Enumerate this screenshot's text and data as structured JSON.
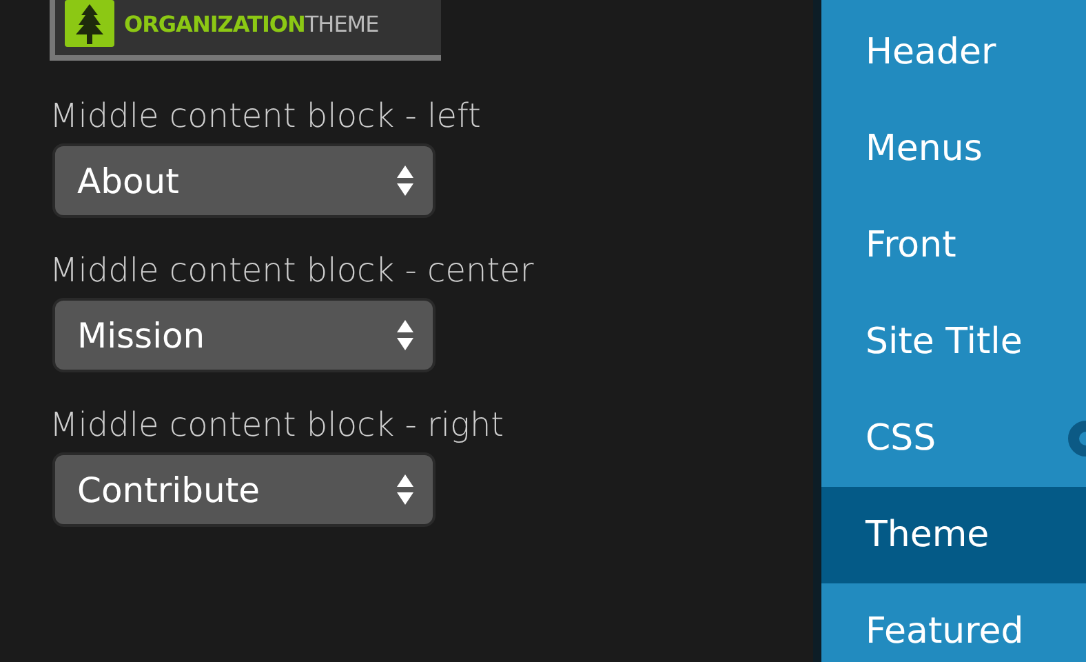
{
  "logo": {
    "brand_bold": "ORGANIZATION",
    "brand_light": "THEME"
  },
  "fields": [
    {
      "label": "Middle content block - left",
      "value": "About"
    },
    {
      "label": "Middle content block - center",
      "value": "Mission"
    },
    {
      "label": "Middle content block - right",
      "value": "Contribute"
    }
  ],
  "sidebar": {
    "items": [
      {
        "label": "Header",
        "selected": false,
        "indicator": false
      },
      {
        "label": "Menus",
        "selected": false,
        "indicator": false
      },
      {
        "label": "Front",
        "selected": false,
        "indicator": false
      },
      {
        "label": "Site Title",
        "selected": false,
        "indicator": false
      },
      {
        "label": "CSS",
        "selected": false,
        "indicator": true
      },
      {
        "label": "Theme",
        "selected": true,
        "indicator": false
      },
      {
        "label": "Featured",
        "selected": false,
        "indicator": false
      }
    ]
  }
}
